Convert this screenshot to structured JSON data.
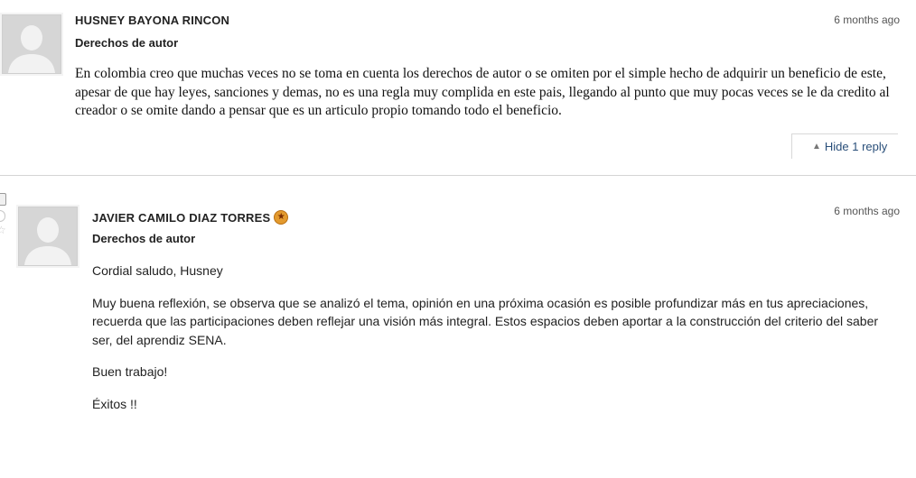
{
  "comments": [
    {
      "author": "HUSNEY BAYONA RINCON",
      "timestamp": "6 months ago",
      "subject": "Derechos de autor",
      "paragraphs": [
        "En colombia creo que muchas veces no se toma en cuenta los derechos de autor o se omiten por el simple hecho de adquirir un beneficio de este, apesar de que hay leyes, sanciones y demas, no es una regla muy complida en este pais, llegando al punto que muy pocas veces se le da credito al creador o se omite dando a pensar que es un articulo propio tomando todo el beneficio."
      ],
      "reply_toggle_label": "Hide 1 reply",
      "reply_toggle_icon": "caret-up-icon"
    },
    {
      "author": "JAVIER CAMILO DIAZ TORRES",
      "author_badge_icon": "instructor-badge-icon",
      "timestamp": "6 months ago",
      "subject": "Derechos de autor",
      "paragraphs": [
        "Cordial saludo, Husney",
        "Muy buena reflexión, se observa que se analizó el tema, opinión en una próxima ocasión es posible profundizar más en tus apreciaciones, recuerda que las participaciones deben reflejar una visión más integral. Estos espacios deben aportar a la construcción del criterio del saber ser, del aprendiz SENA.",
        "Buen trabajo!",
        "Éxitos !!"
      ]
    }
  ],
  "colors": {
    "link": "#2a4f7a",
    "badge": "#e39a2e",
    "divider": "#d4d4d4"
  }
}
